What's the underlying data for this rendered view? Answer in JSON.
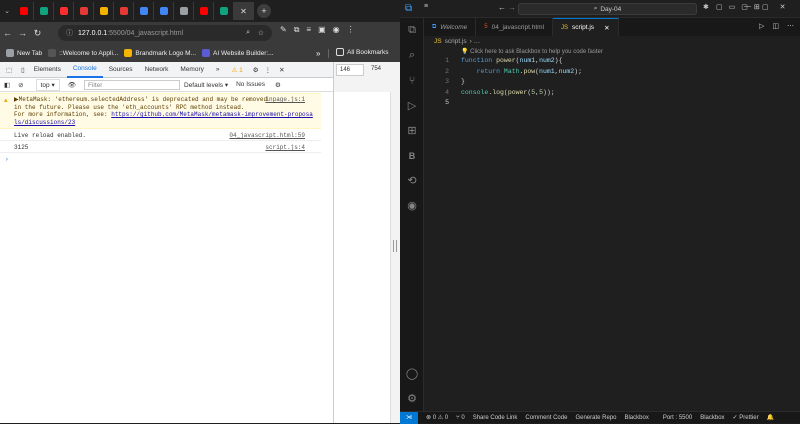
{
  "browser": {
    "tabs": [
      {
        "icon": "youtube-icon",
        "color": "#ff0000"
      },
      {
        "icon": "chatgpt-icon",
        "color": "#10a37f"
      },
      {
        "icon": "pause-icon",
        "color": "#ff2d2d"
      },
      {
        "icon": "pdf-icon",
        "color": "#e53935"
      },
      {
        "icon": "app-icon",
        "color": "#f4b400"
      },
      {
        "icon": "pdf-icon",
        "color": "#e53935"
      },
      {
        "icon": "docs-icon",
        "color": "#4285f4"
      },
      {
        "icon": "docs-icon",
        "color": "#4285f4"
      },
      {
        "icon": "globe-icon",
        "color": "#9aa0a6"
      },
      {
        "icon": "youtube-icon",
        "color": "#ff0000"
      },
      {
        "icon": "chatgpt-icon",
        "color": "#10a37f"
      }
    ],
    "new_tab": "+",
    "url_host": "127.0.0.1",
    "url_path": ":5500/04_javascript.html",
    "bookmarks": [
      {
        "label": "New Tab",
        "icon": "gear-icon"
      },
      {
        "label": "::Welcome to Appli...",
        "icon": "globe-icon"
      },
      {
        "label": "Brandmark Logo M...",
        "icon": "b-icon"
      },
      {
        "label": "AI Website Builder:...",
        "icon": "diamond-icon"
      }
    ],
    "bookmarks_more": "»",
    "all_bookmarks": "All Bookmarks"
  },
  "devtools": {
    "tabs": [
      "Elements",
      "Console",
      "Sources",
      "Network",
      "Memory"
    ],
    "more": "»",
    "warnings_count": "1",
    "close": "✕",
    "dims_w": "146",
    "dims_h": "754",
    "context": "top",
    "filter_placeholder": "Filter",
    "levels": "Default levels",
    "issues": "No Issues",
    "warning": {
      "line1": "▶MetaMask: 'ethereum.selectedAddress' is deprecated and may be removed",
      "line2": "in the future. Please use the 'eth_accounts' RPC method instead.",
      "line3": "For more information, see: ",
      "link": "https://github.com/MetaMask/metamask-improvement-proposals/discussions/23",
      "source": "inpage.js:1"
    },
    "messages": [
      {
        "text": "Live reload enabled.",
        "source": "04_javascript.html:59"
      },
      {
        "text": "3125",
        "source": "script.js:4"
      }
    ],
    "prompt": "›"
  },
  "vscode": {
    "search": "Day-04",
    "tabs": [
      {
        "label": "Welcome",
        "icon": "vscode-icon"
      },
      {
        "label": "04_javascript.html",
        "icon": "html-icon"
      },
      {
        "label": "script.js",
        "icon": "js-icon"
      }
    ],
    "breadcrumb": "script.js",
    "breadcrumb_sep": "› …",
    "codelens": "💡 Click here to ask Blackbox to help you code faster",
    "lines": [
      "1",
      "2",
      "3",
      "4",
      "5"
    ],
    "code": [
      "function power(num1,num2){",
      "    return Math.pow(num1,num2);",
      "}",
      "console.log(power(5,5));",
      ""
    ],
    "status": {
      "problems": "⊗ 0 ⚠ 0",
      "ports": "⑂ 0",
      "share": "Share Code Link",
      "comment": "Comment Code",
      "generate": "Generate Repo",
      "blackbox": "Blackbox",
      "port": "Port : 5500",
      "blackbox2": "Blackbox",
      "prettier": "✓ Prettier"
    }
  }
}
